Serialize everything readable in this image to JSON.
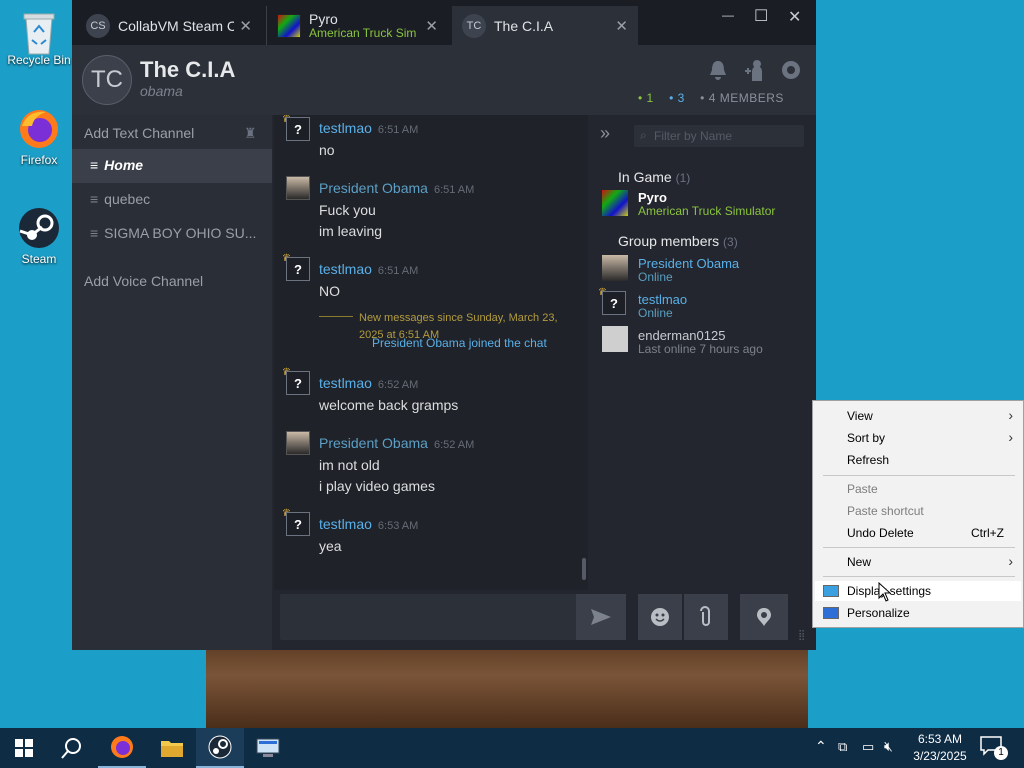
{
  "desktop": {
    "icons": [
      {
        "label": "Recycle Bin"
      },
      {
        "label": "Firefox"
      },
      {
        "label": "Steam"
      }
    ]
  },
  "window": {
    "tabs": [
      {
        "avatar": "CS",
        "title": "CollabVM Steam C"
      },
      {
        "title": "Pyro",
        "subtitle": "American Truck Sim"
      },
      {
        "avatar": "TC",
        "title": "The C.I.A"
      }
    ],
    "controls": {
      "minimize": "—",
      "maximize": "☐",
      "close": "✕"
    }
  },
  "group": {
    "avatar": "TC",
    "name": "The C.I.A",
    "tagline": "obama",
    "stats": {
      "in_game": "1",
      "online": "3",
      "members": "4 MEMBERS"
    }
  },
  "sidebar": {
    "add_text": "Add Text Channel",
    "channels": [
      {
        "name": "Home",
        "active": true
      },
      {
        "name": "quebec"
      },
      {
        "name": "SIGMA BOY OHIO SU..."
      }
    ],
    "add_voice": "Add Voice Channel"
  },
  "chat": {
    "messages": [
      {
        "user": "testlmao",
        "time": "6:51 AM",
        "lines": [
          "no"
        ]
      },
      {
        "user": "President Obama",
        "time": "6:51 AM",
        "lines": [
          "Fuck you",
          "im leaving"
        ]
      },
      {
        "user": "testlmao",
        "time": "6:51 AM",
        "lines": [
          "NO"
        ]
      },
      {
        "user": "testlmao",
        "time": "6:52 AM",
        "lines": [
          "welcome back gramps"
        ]
      },
      {
        "user": "President Obama",
        "time": "6:52 AM",
        "lines": [
          "im not old",
          "i play video games"
        ]
      },
      {
        "user": "testlmao",
        "time": "6:53 AM",
        "lines": [
          "yea"
        ]
      }
    ],
    "divider": "New messages since Sunday, March 23, 2025 at 6:51 AM",
    "joined": "President Obama joined the chat"
  },
  "members": {
    "filter_placeholder": "Filter by Name",
    "in_game_label": "In Game",
    "in_game_count": "(1)",
    "in_game": [
      {
        "name": "Pyro",
        "status": "American Truck Simulator"
      }
    ],
    "group_label": "Group members",
    "group_count": "(3)",
    "group": [
      {
        "name": "President Obama",
        "status": "Online"
      },
      {
        "name": "testlmao",
        "status": "Online"
      },
      {
        "name": "enderman0125",
        "status": "Last online 7 hours ago"
      }
    ]
  },
  "context_menu": {
    "items": [
      {
        "label": "View"
      },
      {
        "label": "Sort by"
      },
      {
        "label": "Refresh"
      },
      {
        "label": "Paste"
      },
      {
        "label": "Paste shortcut"
      },
      {
        "label": "Undo Delete",
        "shortcut": "Ctrl+Z"
      },
      {
        "label": "New"
      },
      {
        "label": "Display settings"
      },
      {
        "label": "Personalize"
      }
    ]
  },
  "taskbar": {
    "time": "6:53 AM",
    "date": "3/23/2025",
    "notifications": "1"
  },
  "colors": {
    "desktop": "#1b9ec7",
    "steam_blue": "#5ab0e8",
    "ingame_green": "#8bc53f",
    "crown": "#e8b53a"
  }
}
